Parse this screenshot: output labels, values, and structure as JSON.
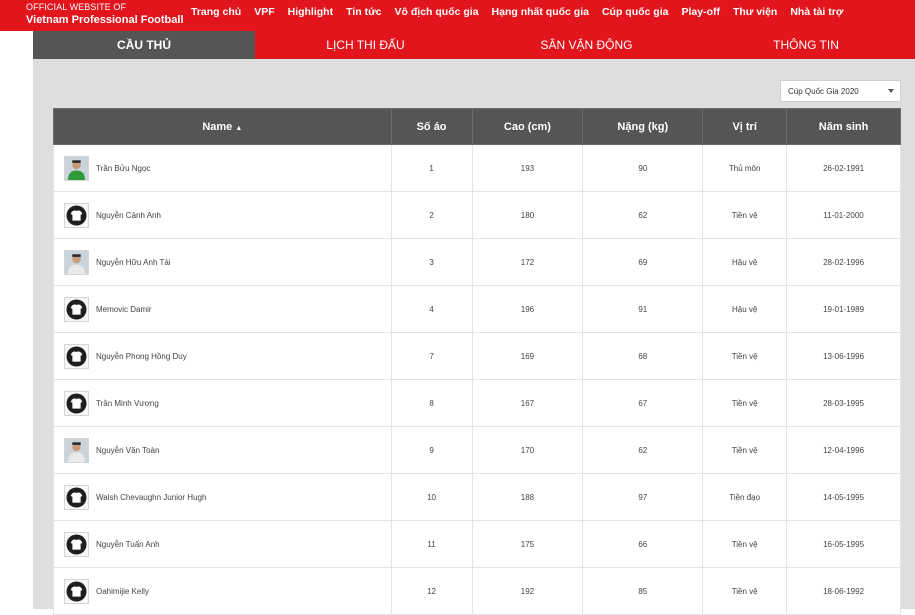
{
  "brand": {
    "line1": "OFFICIAL WEBSITE OF",
    "line2": "Vietnam Professional Football"
  },
  "nav": [
    "Trang chủ",
    "VPF",
    "Highlight",
    "Tin tức",
    "Vô địch quốc gia",
    "Hạng nhất quốc gia",
    "Cúp quốc gia",
    "Play-off",
    "Thư viện",
    "Nhà tài trợ"
  ],
  "tabs": [
    "CẦU THỦ",
    "LỊCH THI ĐẤU",
    "SÂN VẬN ĐỘNG",
    "THÔNG TIN"
  ],
  "active_tab": "CẦU THỦ",
  "season_select": {
    "selected": "Cúp Quốc Gia 2020",
    "icon": "chevron-down-icon"
  },
  "table": {
    "headers": {
      "name": "Name",
      "sort_icon": "▲",
      "number": "Số áo",
      "height": "Cao (cm)",
      "weight": "Nặng (kg)",
      "position": "Vị trí",
      "birth": "Năm sinh"
    },
    "rows": [
      {
        "avatar": "photo-green",
        "name": "Trần Bửu Ngọc",
        "number": "1",
        "height": "193",
        "weight": "90",
        "position": "Thủ môn",
        "birth": "26-02-1991"
      },
      {
        "avatar": "jersey",
        "name": "Nguyễn Cảnh Anh",
        "number": "2",
        "height": "180",
        "weight": "62",
        "position": "Tiền vệ",
        "birth": "11-01-2000"
      },
      {
        "avatar": "photo-white",
        "name": "Nguyễn Hữu Anh Tài",
        "number": "3",
        "height": "172",
        "weight": "69",
        "position": "Hậu vệ",
        "birth": "28-02-1996"
      },
      {
        "avatar": "jersey",
        "name": "Memovic Damir",
        "number": "4",
        "height": "196",
        "weight": "91",
        "position": "Hậu vệ",
        "birth": "19-01-1989"
      },
      {
        "avatar": "jersey",
        "name": "Nguyễn Phong Hồng Duy",
        "number": "7",
        "height": "169",
        "weight": "68",
        "position": "Tiền vệ",
        "birth": "13-06-1996"
      },
      {
        "avatar": "jersey",
        "name": "Trần Minh Vương",
        "number": "8",
        "height": "167",
        "weight": "67",
        "position": "Tiền vệ",
        "birth": "28-03-1995"
      },
      {
        "avatar": "photo-white",
        "name": "Nguyễn Văn Toàn",
        "number": "9",
        "height": "170",
        "weight": "62",
        "position": "Tiền vệ",
        "birth": "12-04-1996"
      },
      {
        "avatar": "jersey",
        "name": "Walsh Chevaughn Junior Hugh",
        "number": "10",
        "height": "188",
        "weight": "97",
        "position": "Tiền đạo",
        "birth": "14-05-1995"
      },
      {
        "avatar": "jersey",
        "name": "Nguyễn Tuấn Anh",
        "number": "11",
        "height": "175",
        "weight": "66",
        "position": "Tiền vệ",
        "birth": "16-05-1995"
      },
      {
        "avatar": "jersey",
        "name": "Oahimijie Kelly",
        "number": "12",
        "height": "192",
        "weight": "85",
        "position": "Tiền vệ",
        "birth": "18-06-1992"
      }
    ]
  },
  "colors": {
    "brand_red": "#e2141c",
    "header_gray": "#555555",
    "content_bg": "#dedede"
  }
}
